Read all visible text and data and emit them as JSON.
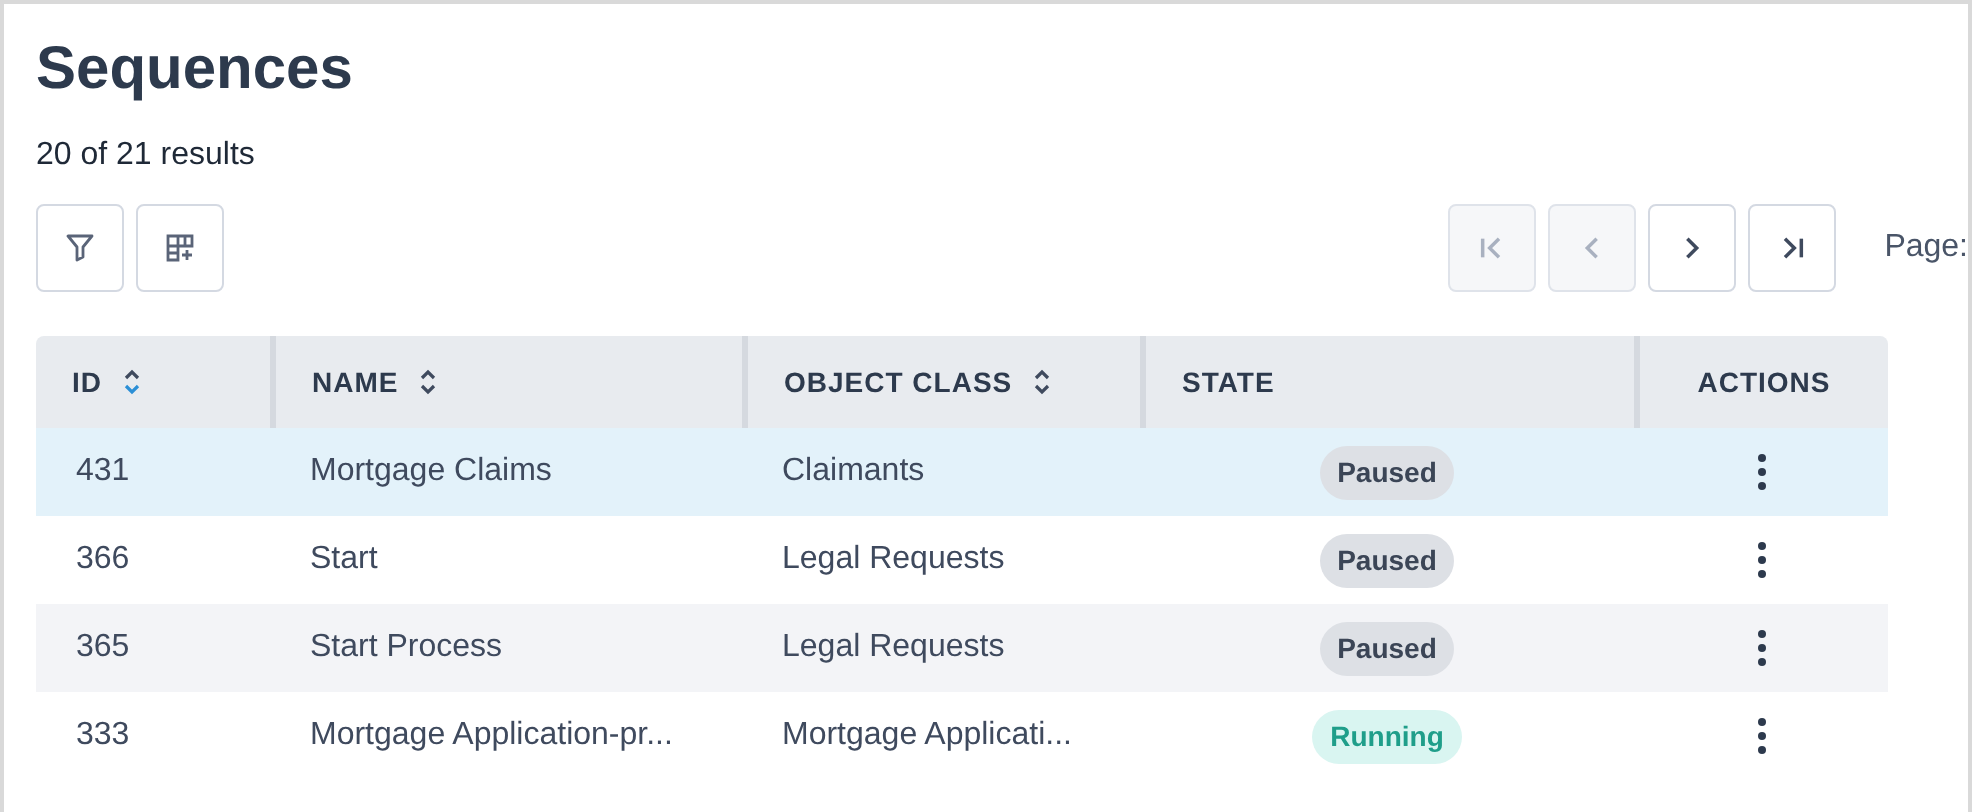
{
  "title": "Sequences",
  "result_count": "20 of 21 results",
  "toolbar": [
    {
      "kind": "filter"
    },
    {
      "kind": "columns"
    }
  ],
  "pagination": {
    "buttons": [
      {
        "kind": "first",
        "disabled": true
      },
      {
        "kind": "prev",
        "disabled": true
      },
      {
        "kind": "next",
        "disabled": false
      },
      {
        "kind": "last",
        "disabled": false
      }
    ],
    "label": "Page:"
  },
  "table": {
    "columns": [
      {
        "label": "ID",
        "sorted": true
      },
      {
        "label": "NAME",
        "sorted": false
      },
      {
        "label": "OBJECT CLASS",
        "sorted": false
      },
      {
        "label": "STATE"
      },
      {
        "label": "ACTIONS"
      }
    ],
    "rows": [
      {
        "id": "431",
        "name": "Mortgage Claims",
        "object_class": "Claimants",
        "state": {
          "label": "Paused",
          "kind": "paused"
        },
        "selected": true
      },
      {
        "id": "366",
        "name": "Start",
        "object_class": "Legal Requests",
        "state": {
          "label": "Paused",
          "kind": "paused"
        },
        "selected": false
      },
      {
        "id": "365",
        "name": "Start Process",
        "object_class": "Legal Requests",
        "state": {
          "label": "Paused",
          "kind": "paused"
        },
        "selected": false
      },
      {
        "id": "333",
        "name": "Mortgage Application-pr...",
        "object_class": "Mortgage Applicati...",
        "state": {
          "label": "Running",
          "kind": "running"
        },
        "selected": false
      }
    ]
  }
}
